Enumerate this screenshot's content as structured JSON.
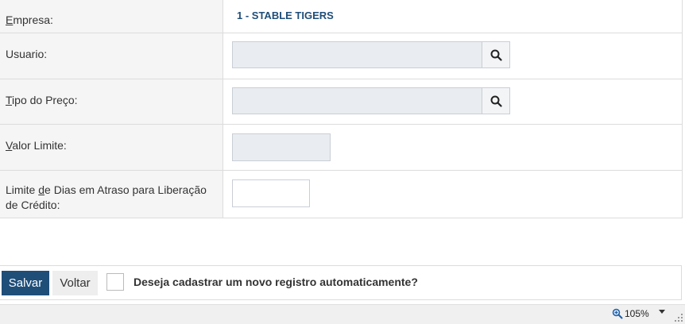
{
  "form": {
    "rows": [
      {
        "label_key": "E",
        "label_rest": "mpresa:",
        "value": "1 - STABLE TIGERS"
      },
      {
        "label": "Usuario:",
        "value": ""
      },
      {
        "label_key": "T",
        "label_rest": "ipo do Preço:",
        "value": ""
      },
      {
        "label_key": "V",
        "label_rest": "alor Limite:",
        "value": ""
      },
      {
        "label_pre": "Limite ",
        "label_key": "d",
        "label_rest": "e Dias em Atraso para Liberação de Crédito:",
        "value": ""
      }
    ]
  },
  "footer": {
    "save_label": "Salvar",
    "back_label": "Voltar",
    "auto_register_label": "Deseja cadastrar um novo registro automaticamente?"
  },
  "statusbar": {
    "zoom": "105%"
  },
  "icons": {
    "lookup": "search-icon",
    "zoom": "zoom-icon",
    "dropdown": "caret-down-icon",
    "resize": "resize-grip-icon"
  },
  "colors": {
    "primary": "#1f4e79",
    "label_bg": "#f5f5f5",
    "readonly_input_bg": "#e9ecf0"
  }
}
